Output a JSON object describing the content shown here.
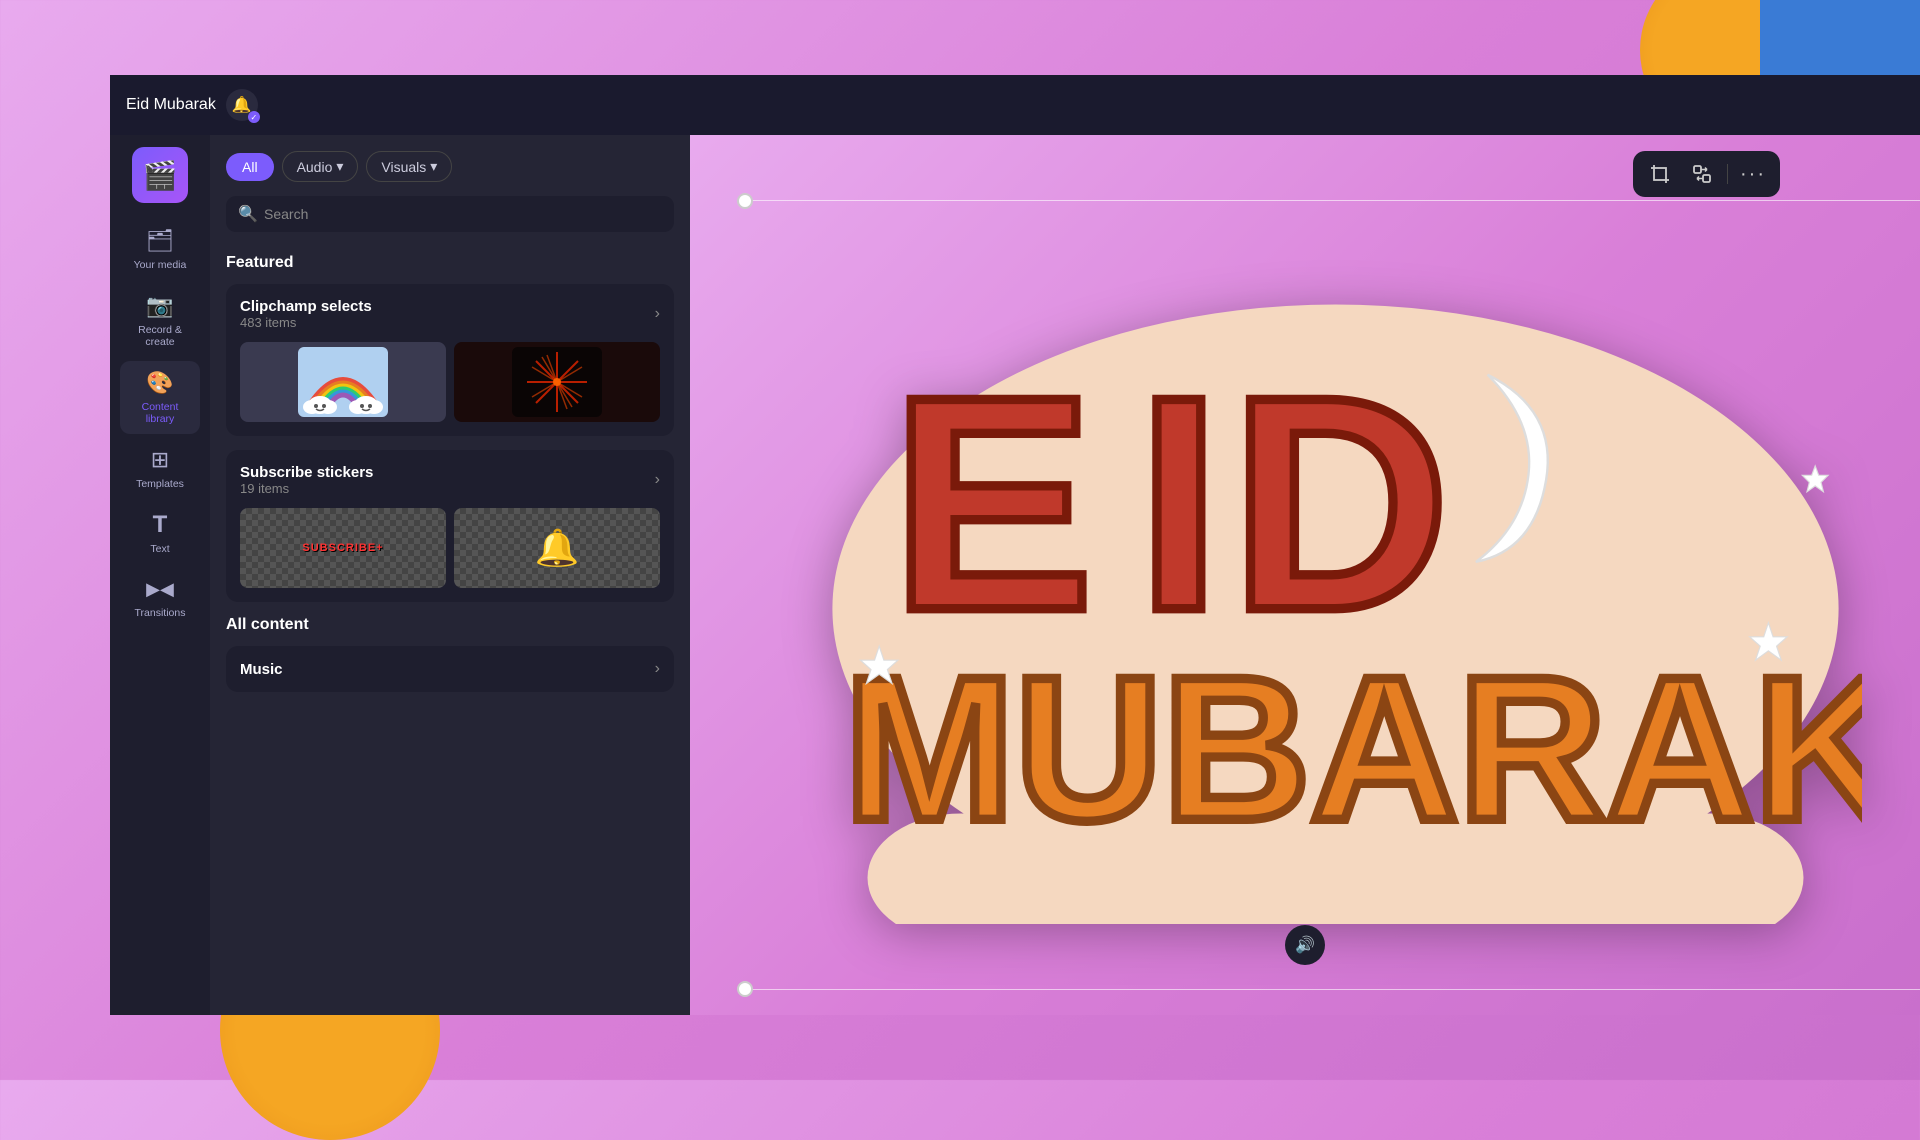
{
  "app": {
    "title": "Clipchamp",
    "project_title": "Eid Mubarak"
  },
  "sidebar": {
    "items": [
      {
        "id": "your-media",
        "label": "Your media",
        "icon": "🗂"
      },
      {
        "id": "record-create",
        "label": "Record &\ncreate",
        "icon": "🎥"
      },
      {
        "id": "content-library",
        "label": "Content\nlibrary",
        "icon": "🎨"
      },
      {
        "id": "templates",
        "label": "Templates",
        "icon": "⊞"
      },
      {
        "id": "text",
        "label": "Text",
        "icon": "T"
      },
      {
        "id": "transitions",
        "label": "Transitions",
        "icon": "▶"
      }
    ]
  },
  "filter_tabs": {
    "all": "All",
    "audio": "Audio",
    "visuals": "Visuals"
  },
  "search": {
    "placeholder": "Search"
  },
  "featured": {
    "section_title": "Featured",
    "clipchamp_selects": {
      "title": "Clipchamp selects",
      "count": "483 items"
    },
    "subscribe_stickers": {
      "title": "Subscribe stickers",
      "count": "19 items"
    }
  },
  "all_content": {
    "section_title": "All content",
    "music": {
      "title": "Music"
    }
  },
  "canvas": {
    "project_title": "Eid Mubarak",
    "toolbar_buttons": [
      "crop",
      "swap",
      "more"
    ]
  }
}
